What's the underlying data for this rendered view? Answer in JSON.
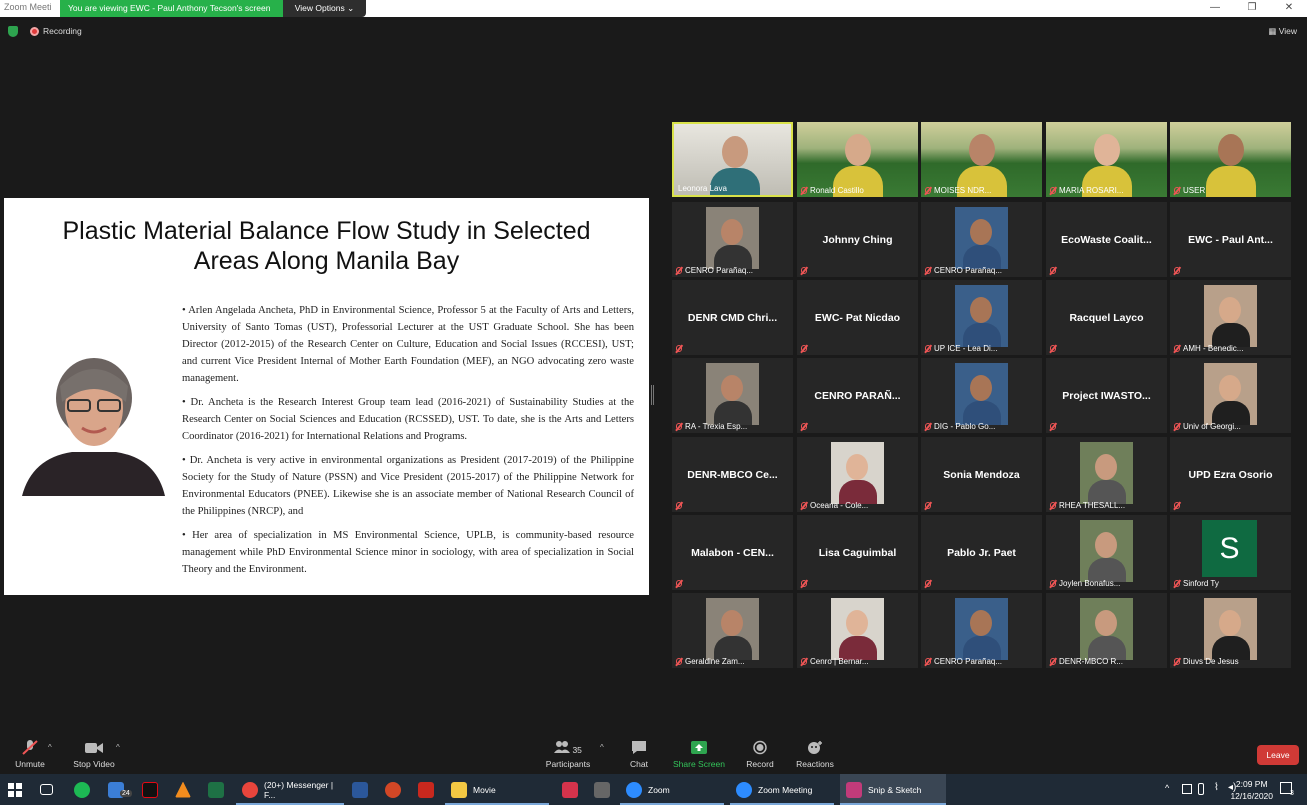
{
  "window": {
    "app_title": "Zoom Meeti",
    "share_banner": "You are viewing EWC - Paul Anthony Tecson's screen",
    "view_options": "View Options"
  },
  "meeting": {
    "recording_label": "Recording",
    "view_label": "View"
  },
  "slide": {
    "title_line1": "Plastic Material Balance Flow Study in Selected",
    "title_line2": "Areas Along Manila Bay",
    "bio": [
      "•  Arlen Angelada Ancheta, PhD in Environmental Science, Professor 5 at the Faculty of Arts and Letters, University of Santo Tomas (UST), Professorial Lecturer at the UST Graduate School. She has  been Director (2012-2015) of the Research Center on Culture, Education and Social Issues (RCCESI), UST; and current Vice President Internal of Mother Earth Foundation (MEF), an NGO advocating zero waste management.",
      "•  Dr. Ancheta is the Research Interest Group team lead (2016-2021) of Sustainability Studies at the Research Center on Social Sciences  and Education (RCSSED), UST. To date, she is the Arts and Letters Coordinator (2016-2021) for International Relations and Programs.",
      "•  Dr. Ancheta is very active in environmental organizations as President (2017-2019) of the Philippine Society for the Study of Nature (PSSN) and Vice President (2015-2017) of the Philippine Network for Environmental Educators (PNEE). Likewise she is an associate member of National Research Council of the Philippines (NRCP), and",
      "•  Her area of specialization in MS Environmental Science, UPLB, is community-based resource management while PhD Environmental Science minor in sociology, with area of specialization in Social Theory and the Environment."
    ]
  },
  "participants": [
    {
      "label": "Leonora Lava",
      "kind": "video",
      "bg": "room",
      "active": true,
      "muted": false
    },
    {
      "label": "Ronald Castillo",
      "kind": "video",
      "bg": "garden",
      "muted": true
    },
    {
      "label": "MOISES NDR...",
      "kind": "video",
      "bg": "garden",
      "muted": true
    },
    {
      "label": "MARIA ROSARI...",
      "kind": "video",
      "bg": "garden",
      "muted": true
    },
    {
      "label": "USER",
      "kind": "video",
      "bg": "garden",
      "muted": true
    },
    {
      "label": "CENRO Parañaq...",
      "kind": "photo",
      "muted": true
    },
    {
      "name": "Johnny Ching",
      "kind": "name",
      "muted": true
    },
    {
      "label": "CENRO Parañaq...",
      "kind": "photo",
      "muted": true
    },
    {
      "name": "EcoWaste  Coalit...",
      "kind": "name",
      "muted": true
    },
    {
      "name": "EWC - Paul Ant...",
      "kind": "name",
      "muted": true
    },
    {
      "name": "DENR CMD Chri...",
      "kind": "name",
      "muted": true
    },
    {
      "name": "EWC- Pat Nicdao",
      "kind": "name",
      "muted": true
    },
    {
      "label": "UP ICE - Lea Di...",
      "kind": "photo",
      "muted": true
    },
    {
      "name": "Racquel Layco",
      "kind": "name",
      "muted": true
    },
    {
      "label": "AMH - Benedic...",
      "kind": "photo",
      "muted": true
    },
    {
      "label": "RA - Trexia Esp...",
      "kind": "photo",
      "muted": true
    },
    {
      "name": "CENRO PARAÑ...",
      "kind": "name",
      "muted": true
    },
    {
      "label": "DIG - Pablo Go...",
      "kind": "photo",
      "muted": true
    },
    {
      "name": "Project  IWASTO...",
      "kind": "name",
      "muted": true
    },
    {
      "label": "Univ of Georgi...",
      "kind": "photo",
      "muted": true
    },
    {
      "name": "DENR-MBCO  Ce...",
      "kind": "name",
      "muted": true
    },
    {
      "label": "Oceana - Cole...",
      "kind": "photo",
      "muted": true
    },
    {
      "name": "Sonia Mendoza",
      "kind": "name",
      "muted": true
    },
    {
      "label": "RHEA THESALL...",
      "kind": "photo",
      "muted": true
    },
    {
      "name": "UPD Ezra Osorio",
      "kind": "name",
      "muted": true
    },
    {
      "name": "Malabon  - CEN...",
      "kind": "name",
      "muted": true
    },
    {
      "name": "Lisa Caguimbal",
      "kind": "name",
      "muted": true
    },
    {
      "name": "Pablo Jr. Paet",
      "kind": "name",
      "muted": true
    },
    {
      "label": "Joylen Bonafus...",
      "kind": "photo",
      "muted": true
    },
    {
      "label": "Sinford Ty",
      "kind": "avatar",
      "initial": "S",
      "muted": true
    },
    {
      "label": "Geraldine Zam...",
      "kind": "photo",
      "muted": true
    },
    {
      "label": "Cenro | Bernar...",
      "kind": "photo",
      "muted": true
    },
    {
      "label": "CENRO Parañaq...",
      "kind": "photo",
      "muted": true
    },
    {
      "label": "DENR-MBCO R...",
      "kind": "photo",
      "muted": true
    },
    {
      "label": "Diuvs De Jesus",
      "kind": "photo",
      "muted": true
    }
  ],
  "toolbar": {
    "unmute": "Unmute",
    "stop_video": "Stop Video",
    "participants_count": "35",
    "participants": "Participants",
    "chat": "Chat",
    "share_screen": "Share Screen",
    "record": "Record",
    "reactions": "Reactions",
    "leave": "Leave"
  },
  "taskbar": {
    "mail_badge": "24",
    "messenger": "(20+) Messenger | F...",
    "movie": "Movie",
    "zoom": "Zoom",
    "zoom_meeting": "Zoom Meeting",
    "snip": "Snip & Sketch",
    "time": "2:09 PM",
    "date": "12/16/2020",
    "notif": "3"
  },
  "colors": {
    "accent_green": "#27b14a",
    "leave_red": "#d03a36",
    "active_border": "#d9e24a"
  }
}
